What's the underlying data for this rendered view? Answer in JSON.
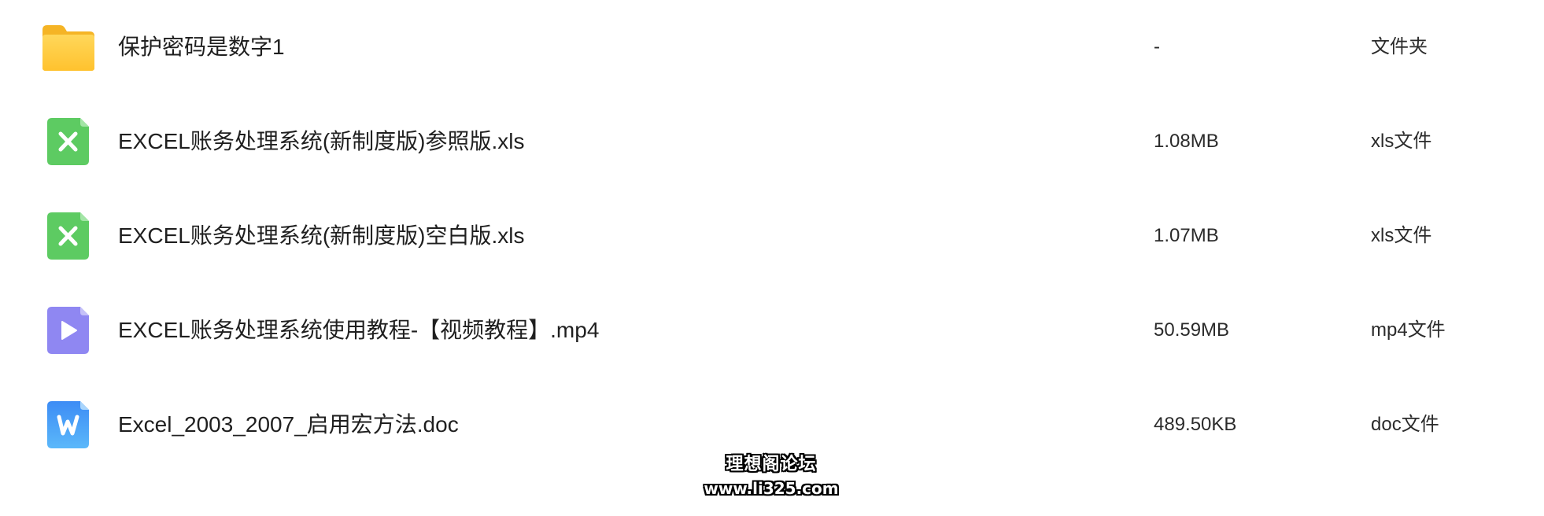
{
  "files": [
    {
      "name": "保护密码是数字1",
      "size": "-",
      "type": "文件夹",
      "icon": "folder-icon",
      "color": "#FFC93C"
    },
    {
      "name": "EXCEL账务处理系统(新制度版)参照版.xls",
      "size": "1.08MB",
      "type": "xls文件",
      "icon": "excel-file-icon",
      "color": "#5DCB62"
    },
    {
      "name": "EXCEL账务处理系统(新制度版)空白版.xls",
      "size": "1.07MB",
      "type": "xls文件",
      "icon": "excel-file-icon",
      "color": "#5DCB62"
    },
    {
      "name": "EXCEL账务处理系统使用教程-【视频教程】.mp4",
      "size": "50.59MB",
      "type": "mp4文件",
      "icon": "video-file-icon",
      "color": "#8F87F2"
    },
    {
      "name": "Excel_2003_2007_启用宏方法.doc",
      "size": "489.50KB",
      "type": "doc文件",
      "icon": "word-file-icon",
      "color": "#3D9BF7"
    }
  ],
  "watermark": {
    "line1": "理想阁论坛",
    "line2": "www.li325.com"
  }
}
